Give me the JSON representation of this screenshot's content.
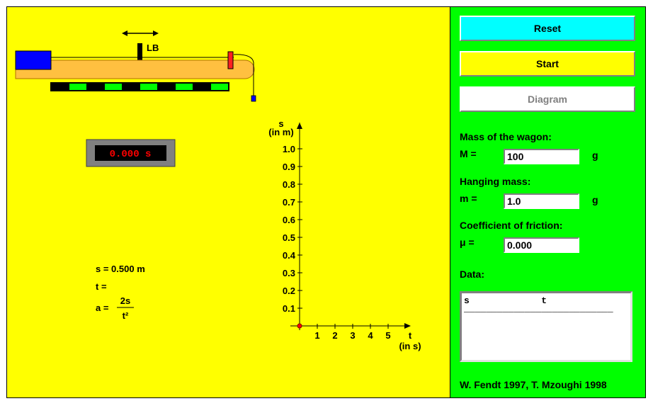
{
  "apparatus": {
    "light_barrier_label": "LB"
  },
  "timer": {
    "display": "0.000 s"
  },
  "formulas": {
    "s_line": "s = 0.500 m",
    "t_line": "t =",
    "a_label": "a =",
    "a_numerator": "2s",
    "a_denominator": "t²"
  },
  "graph": {
    "y_axis_label": "s",
    "y_axis_unit": "(in m)",
    "x_axis_label": "t",
    "x_axis_unit": "(in s)",
    "y_ticks": [
      "1.0",
      "0.9",
      "0.8",
      "0.7",
      "0.6",
      "0.5",
      "0.4",
      "0.3",
      "0.2",
      "0.1"
    ],
    "x_ticks": [
      "1",
      "2",
      "3",
      "4",
      "5"
    ]
  },
  "controls": {
    "reset_label": "Reset",
    "start_label": "Start",
    "diagram_label": "Diagram",
    "wagon_mass_heading": "Mass of the wagon:",
    "wagon_mass_symbol": "M =",
    "wagon_mass_value": "100",
    "wagon_mass_unit": "g",
    "hanging_mass_heading": "Hanging mass:",
    "hanging_mass_symbol": "m =",
    "hanging_mass_value": "1.0",
    "hanging_mass_unit": "g",
    "friction_heading": "Coefficient of friction:",
    "friction_symbol": "μ =",
    "friction_value": "0.000",
    "data_heading": "Data:",
    "data_col_s": "s",
    "data_col_t": "t",
    "credits": "W. Fendt 1997,  T. Mzoughi 1998"
  },
  "colors": {
    "sim_background": "#ffff00",
    "control_background": "#00ff00",
    "reset_button": "#00ffff",
    "start_button": "#ffff00",
    "diagram_button": "#ffffff",
    "wagon": "#0000ff",
    "track": "#ffc040",
    "timer_digits": "#ff0000"
  }
}
